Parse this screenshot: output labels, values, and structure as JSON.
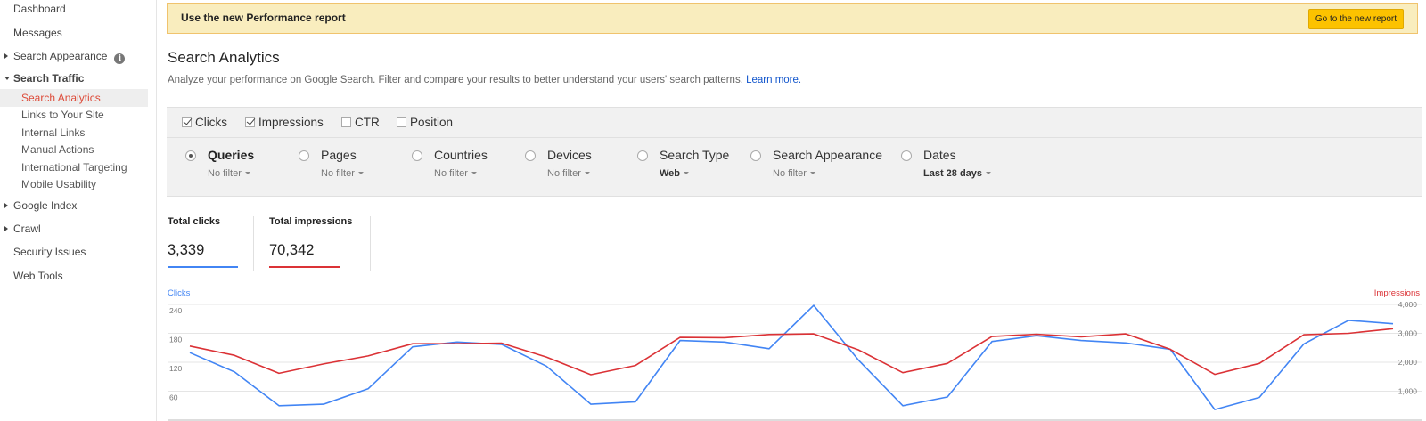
{
  "sidebar": {
    "items": [
      {
        "label": "Dashboard",
        "level": 1
      },
      {
        "label": "Messages",
        "level": 1
      },
      {
        "label": "Search Appearance",
        "level": 1
      },
      {
        "label": "Search Traffic",
        "level": 1
      },
      {
        "label": "Search Analytics",
        "level": 2
      },
      {
        "label": "Links to Your Site",
        "level": 2
      },
      {
        "label": "Internal Links",
        "level": 2
      },
      {
        "label": "Manual Actions",
        "level": 2
      },
      {
        "label": "International Targeting",
        "level": 2
      },
      {
        "label": "Mobile Usability",
        "level": 2
      },
      {
        "label": "Google Index",
        "level": 1
      },
      {
        "label": "Crawl",
        "level": 1
      },
      {
        "label": "Security Issues",
        "level": 1
      },
      {
        "label": "Web Tools",
        "level": 1
      }
    ],
    "info_glyph": "i",
    "active_item": "Search Analytics"
  },
  "banner": {
    "text": "Use the new Performance report",
    "button": "Go to the new report"
  },
  "page": {
    "title": "Search Analytics",
    "description": "Analyze your performance on Google Search. Filter and compare your results to better understand your users' search patterns.",
    "learn_more": "Learn more."
  },
  "metrics": [
    {
      "label": "Clicks",
      "checked": true
    },
    {
      "label": "Impressions",
      "checked": true
    },
    {
      "label": "CTR",
      "checked": false
    },
    {
      "label": "Position",
      "checked": false
    }
  ],
  "dimensions": [
    {
      "label": "Queries",
      "filter": "No filter",
      "selected": true
    },
    {
      "label": "Pages",
      "filter": "No filter",
      "selected": false
    },
    {
      "label": "Countries",
      "filter": "No filter",
      "selected": false
    },
    {
      "label": "Devices",
      "filter": "No filter",
      "selected": false
    },
    {
      "label": "Search Type",
      "filter": "Web",
      "selected": false
    },
    {
      "label": "Search Appearance",
      "filter": "No filter",
      "selected": false
    },
    {
      "label": "Dates",
      "filter": "Last 28 days",
      "selected": false
    }
  ],
  "totals": {
    "clicks_label": "Total clicks",
    "clicks_value": "3,339",
    "impressions_label": "Total impressions",
    "impressions_value": "70,342"
  },
  "colors": {
    "clicks": "#4285f4",
    "impressions": "#db3236"
  },
  "chart_data": {
    "type": "line",
    "x": [
      1,
      2,
      3,
      4,
      5,
      6,
      7,
      8,
      9,
      10,
      11,
      12,
      13,
      14,
      15,
      16,
      17,
      18,
      19,
      20,
      21,
      22,
      23,
      24,
      25,
      26,
      27,
      28
    ],
    "series": [
      {
        "name": "Clicks",
        "axis": "left",
        "values": [
          140,
          100,
          30,
          33,
          65,
          152,
          162,
          157,
          112,
          33,
          38,
          165,
          162,
          148,
          238,
          125,
          30,
          48,
          163,
          175,
          165,
          160,
          147,
          22,
          47,
          158,
          207,
          200
        ]
      },
      {
        "name": "Impressions",
        "axis": "right",
        "values": [
          2560,
          2240,
          1620,
          1940,
          2220,
          2640,
          2640,
          2660,
          2180,
          1570,
          1890,
          2860,
          2850,
          2960,
          2980,
          2430,
          1640,
          1960,
          2890,
          2970,
          2880,
          2980,
          2450,
          1580,
          1960,
          2950,
          3000,
          3160
        ]
      }
    ],
    "y_left_label": "Clicks",
    "y_right_label": "Impressions",
    "y_left_ticks": [
      "240",
      "180",
      "120",
      "60"
    ],
    "y_left_tick_values": [
      240,
      180,
      120,
      60
    ],
    "y_left_range": [
      0,
      240
    ],
    "y_right_ticks": [
      "4,000",
      "3,000",
      "2,000",
      "1,000"
    ],
    "y_right_tick_values": [
      4000,
      3000,
      2000,
      1000
    ],
    "y_right_range": [
      0,
      4000
    ],
    "grid": true
  }
}
